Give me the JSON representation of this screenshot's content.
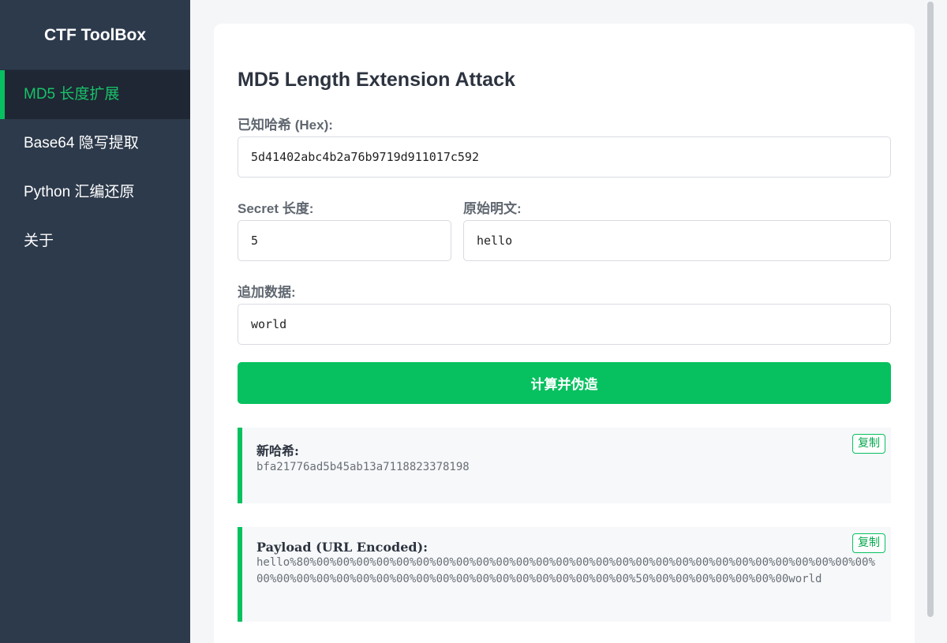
{
  "sidebar": {
    "brand": "CTF ToolBox",
    "items": [
      {
        "label": "MD5 长度扩展",
        "active": true
      },
      {
        "label": "Base64 隐写提取",
        "active": false
      },
      {
        "label": "Python 汇编还原",
        "active": false
      },
      {
        "label": "关于",
        "active": false
      }
    ]
  },
  "form": {
    "title": "MD5 Length Extension Attack",
    "known_hash_label": "已知哈希 (Hex):",
    "known_hash_value": "5d41402abc4b2a76b9719d911017c592",
    "secret_length_label": "Secret 长度:",
    "secret_length_value": "5",
    "original_text_label": "原始明文:",
    "original_text_value": "hello",
    "append_data_label": "追加数据:",
    "append_data_value": "world",
    "submit_label": "计算并伪造"
  },
  "results": {
    "new_hash_title": "新哈希:",
    "new_hash_value": "bfa21776ad5b45ab13a7118823378198",
    "payload_title": "Payload (URL Encoded):",
    "payload_value": "hello%80%00%00%00%00%00%00%00%00%00%00%00%00%00%00%00%00%00%00%00%00%00%00%00%00%00%00%00%00%00%00%00%00%00%00%00%00%00%00%00%00%00%00%00%00%00%00%00%50%00%00%00%00%00%00%00world",
    "copy_label": "复制"
  },
  "colors": {
    "accent": "#07c160",
    "sidebar_bg": "#2d3a4b"
  }
}
